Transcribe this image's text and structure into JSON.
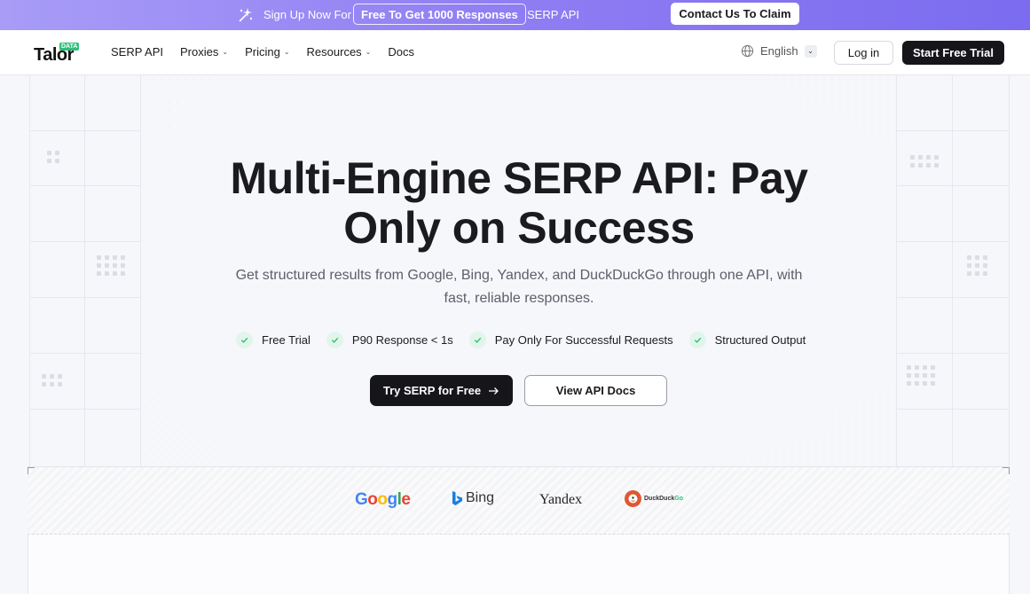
{
  "promo": {
    "lead": "Sign Up Now For",
    "chip": "Free To Get 1000 Responses",
    "tail": "SERP API",
    "claim": "Contact Us To Claim"
  },
  "nav": {
    "logo_word": "Talor",
    "logo_tag": "DATA",
    "items": [
      {
        "label": "SERP API",
        "dropdown": false
      },
      {
        "label": "Proxies",
        "dropdown": true
      },
      {
        "label": "Pricing",
        "dropdown": true
      },
      {
        "label": "Resources",
        "dropdown": true
      },
      {
        "label": "Docs",
        "dropdown": false
      }
    ],
    "language": "English",
    "login": "Log in",
    "start_trial": "Start Free Trial"
  },
  "hero": {
    "title_line1": "Multi-Engine SERP API: Pay",
    "title_line2": "Only on Success",
    "subtitle": "Get structured results from Google, Bing, Yandex, and DuckDuckGo through one API, with fast, reliable responses.",
    "features": [
      "Free Trial",
      "P90 Response < 1s",
      "Pay Only For Successful Requests",
      "Structured Output"
    ],
    "cta_primary": "Try SERP for Free",
    "cta_secondary": "View API Docs"
  },
  "engines": {
    "google": "Google",
    "bing": "Bing",
    "yandex": "Yandex",
    "duckduckgo_duck": "Duck",
    "duckduckgo_go": "Go"
  },
  "colors": {
    "accent": "#8f7df3",
    "dark": "#16161a",
    "check_green": "#2fbf7a",
    "google_blue": "#4285f4",
    "google_red": "#ea4335",
    "google_yellow": "#fbbc05",
    "google_green": "#34a853",
    "ddg_orange": "#de5833",
    "ddg_go_green": "#2fbf7a"
  }
}
